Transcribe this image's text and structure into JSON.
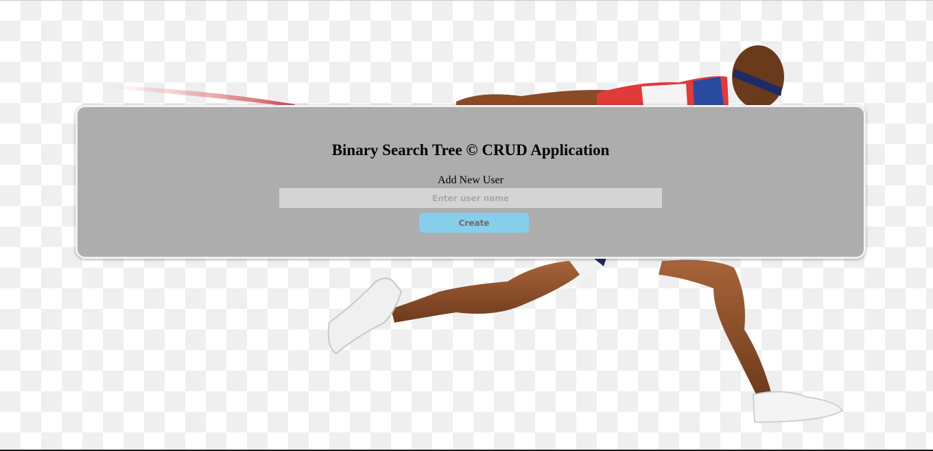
{
  "app": {
    "title": "Binary Search Tree © CRUD Application"
  },
  "form": {
    "section_label": "Add New User",
    "name_input": {
      "value": "",
      "placeholder": "Enter user name"
    },
    "create_label": "Create"
  },
  "colors": {
    "panel": "#adadad",
    "input_background": "#d4d4d4",
    "button": "#87ceeb"
  },
  "background": {
    "icon": "sprinter-image"
  }
}
